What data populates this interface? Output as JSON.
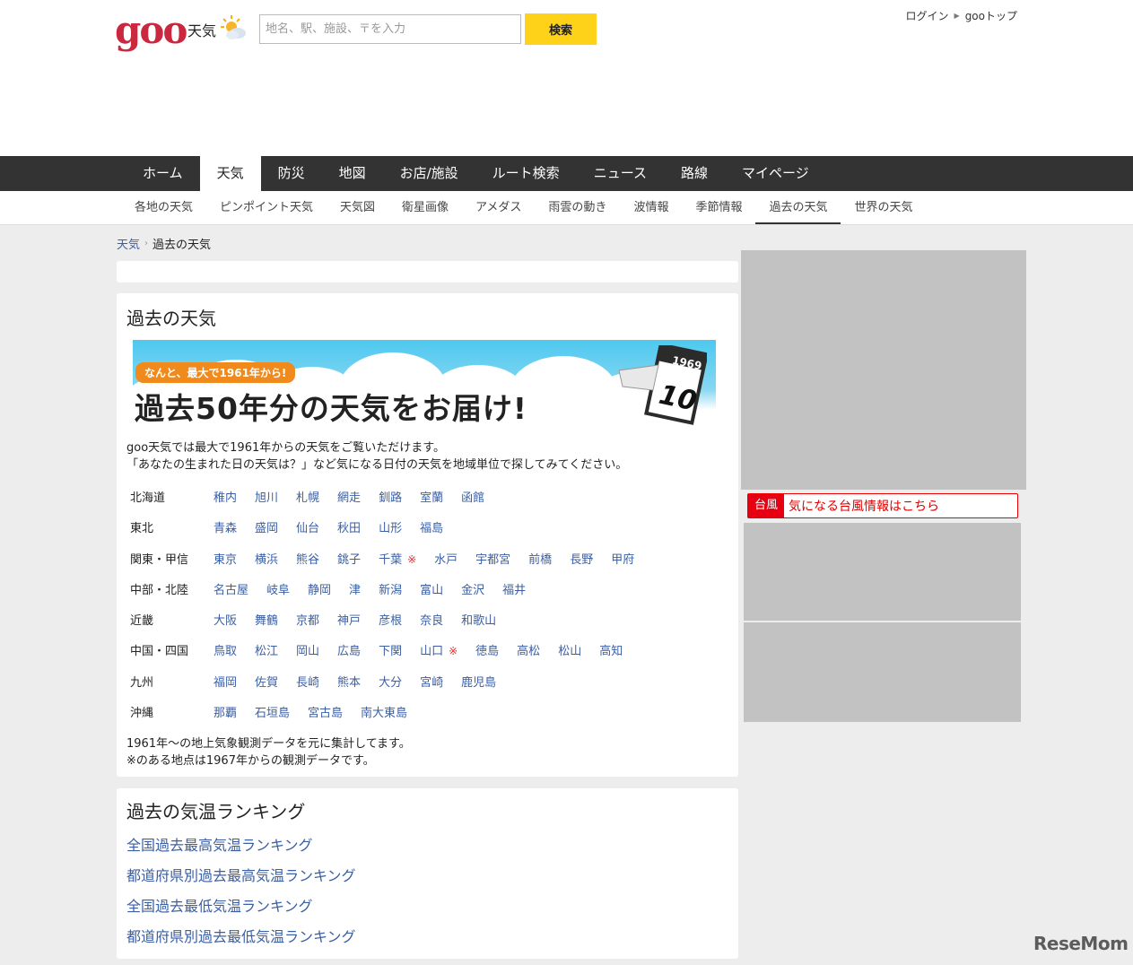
{
  "header": {
    "logo": "goo",
    "logo_sub": "天気",
    "search_placeholder": "地名、駅、施設、〒を入力",
    "search_button": "検索",
    "login": "ログイン",
    "goo_top": "gooトップ"
  },
  "main_nav": [
    "ホーム",
    "天気",
    "防災",
    "地図",
    "お店/施設",
    "ルート検索",
    "ニュース",
    "路線",
    "マイページ"
  ],
  "sub_nav": [
    "各地の天気",
    "ピンポイント天気",
    "天気図",
    "衛星画像",
    "アメダス",
    "雨雲の動き",
    "波情報",
    "季節情報",
    "過去の天気",
    "世界の天気"
  ],
  "breadcrumb": {
    "home": "天気",
    "current": "過去の天気"
  },
  "past_weather": {
    "title": "過去の天気",
    "banner_tag": "なんと、最大で1961年から!",
    "banner_headline": "過去50年分の天気をお届け!",
    "calendar_year": "1969",
    "calendar_day": "10",
    "intro_1": "goo天気では最大で1961年からの天気をご覧いただけます。",
    "intro_2": "「あなたの生まれた日の天気は？」など気になる日付の天気を地域単位で探してみてください。",
    "regions": [
      {
        "name": "北海道",
        "cities": [
          "稚内",
          "旭川",
          "札幌",
          "網走",
          "釧路",
          "室蘭",
          "函館"
        ]
      },
      {
        "name": "東北",
        "cities": [
          "青森",
          "盛岡",
          "仙台",
          "秋田",
          "山形",
          "福島"
        ]
      },
      {
        "name": "関東・甲信",
        "cities": [
          "東京",
          "横浜",
          "熊谷",
          "銚子",
          "千葉 ※",
          "水戸",
          "宇都宮",
          "前橋",
          "長野",
          "甲府"
        ]
      },
      {
        "name": "中部・北陸",
        "cities": [
          "名古屋",
          "岐阜",
          "静岡",
          "津",
          "新潟",
          "富山",
          "金沢",
          "福井"
        ]
      },
      {
        "name": "近畿",
        "cities": [
          "大阪",
          "舞鶴",
          "京都",
          "神戸",
          "彦根",
          "奈良",
          "和歌山"
        ]
      },
      {
        "name": "中国・四国",
        "cities": [
          "鳥取",
          "松江",
          "岡山",
          "広島",
          "下関",
          "山口 ※",
          "徳島",
          "高松",
          "松山",
          "高知"
        ]
      },
      {
        "name": "九州",
        "cities": [
          "福岡",
          "佐賀",
          "長崎",
          "熊本",
          "大分",
          "宮崎",
          "鹿児島"
        ]
      },
      {
        "name": "沖縄",
        "cities": [
          "那覇",
          "石垣島",
          "宮古島",
          "南大東島"
        ]
      }
    ],
    "note_1": "1961年～の地上気象観測データを元に集計してます。",
    "note_2": "※のある地点は1967年からの観測データです。"
  },
  "ranking": {
    "title": "過去の気温ランキング",
    "links": [
      "全国過去最高気温ランキング",
      "都道府県別過去最高気温ランキング",
      "全国過去最低気温ランキング",
      "都道府県別過去最低気温ランキング"
    ]
  },
  "sidebar": {
    "typhoon_badge": "台風",
    "typhoon_text": "気になる台風情報はこちら"
  },
  "watermark": "ReseMom",
  "colors": {
    "logo": "#c9283e",
    "search_button": "#ffd21a",
    "nav_bg": "#333333",
    "link": "#3a5fa5",
    "typhoon": "#e60012"
  }
}
